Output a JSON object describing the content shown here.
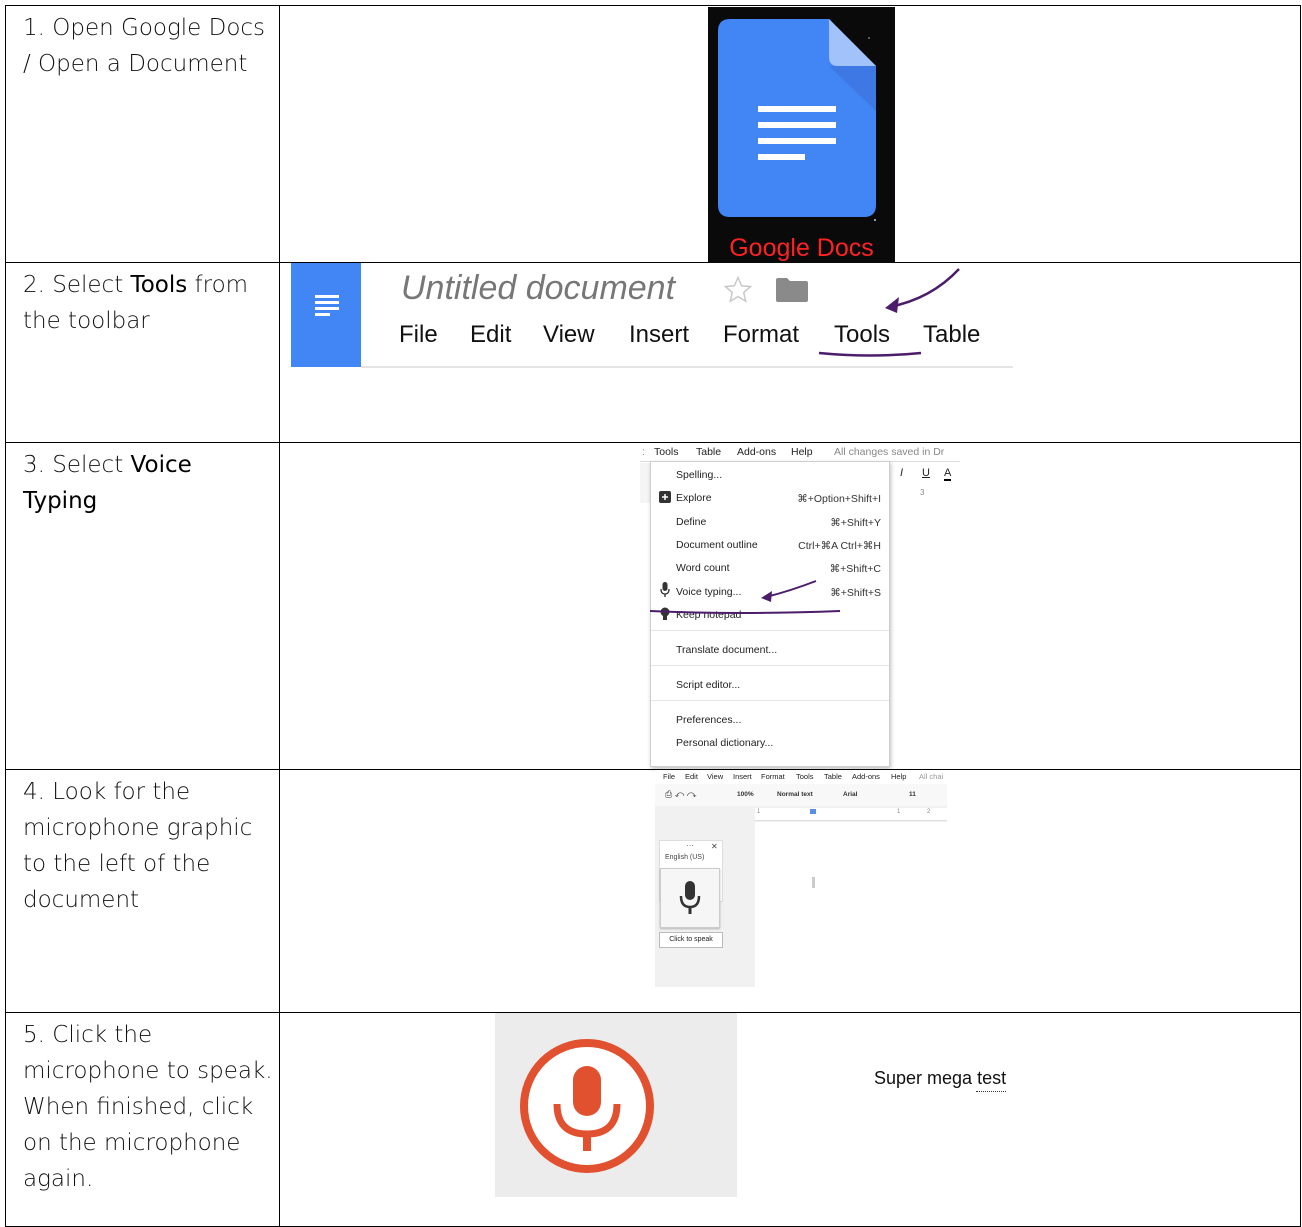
{
  "steps": [
    {
      "number": "1.",
      "text": "Open Google Docs / Open a Document",
      "bold": ""
    },
    {
      "number": "2.",
      "pre": "Select",
      "bold": "Tools",
      "post": "from the toolbar"
    },
    {
      "number": "3.",
      "pre": "Select",
      "bold": "Voice Typing",
      "post": ""
    },
    {
      "number": "4.",
      "text": "Look for the microphone graphic to the left of the document"
    },
    {
      "number": "5.",
      "text": "Click the microphone to speak. When finished, click on the microphone again."
    }
  ],
  "row1": {
    "logo_label": "Google Docs",
    "brand_color": "#4285f4",
    "label_color": "#ff2222",
    "icon": "docs-logo-icon"
  },
  "row2": {
    "doc_title": "Untitled document",
    "menu": [
      "File",
      "Edit",
      "View",
      "Insert",
      "Format",
      "Tools",
      "Table"
    ],
    "annotation_color": "#4b1d6b"
  },
  "row3": {
    "bar": [
      "Tools",
      "Table",
      "Add-ons",
      "Help",
      "All changes saved in Dr"
    ],
    "format_icons": [
      "I",
      "U",
      "A"
    ],
    "ruler_mark": "3",
    "items": [
      {
        "label": "Spelling...",
        "shortcut": "",
        "icon": ""
      },
      {
        "label": "Explore",
        "shortcut": "⌘+Option+Shift+I",
        "icon": "explore-icon"
      },
      {
        "label": "Define",
        "shortcut": "⌘+Shift+Y",
        "icon": ""
      },
      {
        "label": "Document outline",
        "shortcut": "Ctrl+⌘A Ctrl+⌘H",
        "icon": ""
      },
      {
        "label": "Word count",
        "shortcut": "⌘+Shift+C",
        "icon": ""
      },
      {
        "label": "Voice typing...",
        "shortcut": "⌘+Shift+S",
        "icon": "mic-icon"
      },
      {
        "label": "Keep notepad",
        "shortcut": "",
        "icon": "bulb-icon"
      },
      {
        "label": "Translate document...",
        "shortcut": "",
        "icon": ""
      },
      {
        "label": "Script editor...",
        "shortcut": "",
        "icon": ""
      },
      {
        "label": "Preferences...",
        "shortcut": "",
        "icon": ""
      },
      {
        "label": "Personal dictionary...",
        "shortcut": "",
        "icon": ""
      }
    ]
  },
  "row4": {
    "menubar": [
      "File",
      "Edit",
      "View",
      "Insert",
      "Format",
      "Tools",
      "Table",
      "Add-ons",
      "Help",
      "All chai"
    ],
    "toolbar": {
      "zoom": "100%",
      "style": "Normal text",
      "font": "Arial",
      "size": "11"
    },
    "ruler": [
      "1",
      "1",
      "2"
    ],
    "panel_dots": "···",
    "panel_close": "✕",
    "language": "English (US)",
    "tooltip": "Click to speak"
  },
  "row5": {
    "sample_text_a": "Super mega",
    "sample_text_b": "test",
    "mic_color": "#e1502f"
  }
}
